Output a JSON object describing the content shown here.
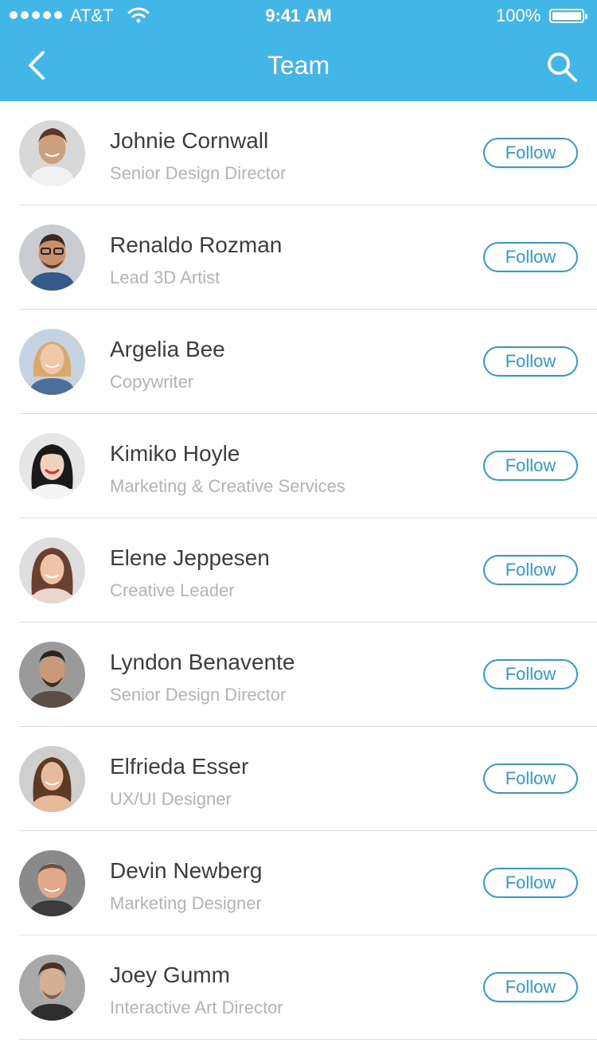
{
  "status_bar": {
    "carrier": "AT&T",
    "time": "9:41 AM",
    "battery": "100%"
  },
  "nav": {
    "title": "Team",
    "back_icon": "chevron-left-icon",
    "search_icon": "search-icon"
  },
  "colors": {
    "header": "#43b6e8",
    "accent": "#2f9bd2",
    "name_text": "#3d3d3d",
    "role_text": "#b3b3b3"
  },
  "members": [
    {
      "name": "Johnie Cornwall",
      "role": "Senior Design Director",
      "action": "Follow"
    },
    {
      "name": "Renaldo Rozman",
      "role": "Lead 3D Artist",
      "action": "Follow"
    },
    {
      "name": "Argelia Bee",
      "role": "Copywriter",
      "action": "Follow"
    },
    {
      "name": "Kimiko Hoyle",
      "role": "Marketing & Creative Services",
      "action": "Follow"
    },
    {
      "name": "Elene Jeppesen",
      "role": "Creative Leader",
      "action": "Follow"
    },
    {
      "name": "Lyndon Benavente",
      "role": "Senior Design Director",
      "action": "Follow"
    },
    {
      "name": "Elfrieda Esser",
      "role": "UX/UI Designer",
      "action": "Follow"
    },
    {
      "name": "Devin Newberg",
      "role": "Marketing Designer",
      "action": "Follow"
    },
    {
      "name": "Joey Gumm",
      "role": "Interactive Art Director",
      "action": "Follow"
    }
  ]
}
